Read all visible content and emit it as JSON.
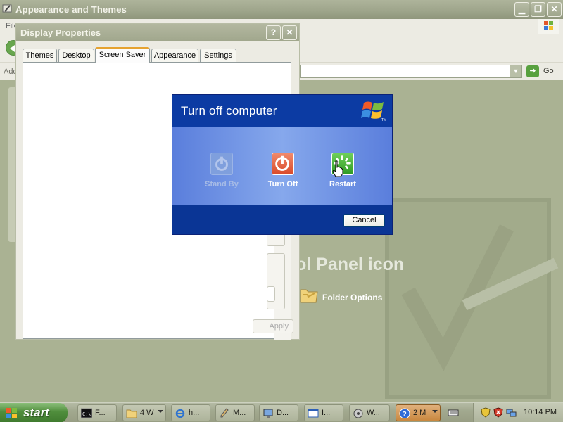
{
  "background_window": {
    "title": "Appearance and Themes",
    "menu_file": "File",
    "address_label": "Address",
    "go_label": "Go",
    "watermark_title": "ol Panel icon",
    "folder_options_label": "Folder Options",
    "minimize_glyph": "▁",
    "restore_glyph": "❐",
    "close_glyph": "✕"
  },
  "display_properties": {
    "title": "Display Properties",
    "help_glyph": "?",
    "close_glyph": "✕",
    "tabs": [
      {
        "label": "Themes"
      },
      {
        "label": "Desktop"
      },
      {
        "label": "Screen Saver",
        "active": true
      },
      {
        "label": "Appearance"
      },
      {
        "label": "Settings"
      }
    ],
    "apply_label": "Apply"
  },
  "turn_off_dialog": {
    "title": "Turn off computer",
    "trademark": "TM",
    "options": [
      {
        "label": "Stand By",
        "icon": "standby-icon",
        "enabled": false
      },
      {
        "label": "Turn Off",
        "icon": "power-icon",
        "enabled": true
      },
      {
        "label": "Restart",
        "icon": "restart-icon",
        "enabled": true
      }
    ],
    "cancel_label": "Cancel"
  },
  "taskbar": {
    "start_label": "start",
    "buttons": [
      {
        "label": "F...",
        "icon": "cmd-icon"
      },
      {
        "label": "4 W",
        "icon": "folder-icon",
        "grouped": true
      },
      {
        "label": "h...",
        "icon": "ie-icon",
        "grouped": true
      },
      {
        "label": "M...",
        "icon": "paint-icon"
      },
      {
        "label": "D...",
        "icon": "control-panel-icon"
      },
      {
        "label": "I...",
        "icon": "window-icon"
      },
      {
        "label": "W...",
        "icon": "speaker-icon"
      },
      {
        "label": "2 M",
        "icon": "help-icon",
        "grouped": true,
        "active": true
      },
      {
        "label": "",
        "icon": "keyboard-icon"
      }
    ],
    "clock": "10:14 PM"
  },
  "colors": {
    "xp_blue": "#083493",
    "turnoff_red": "#d94a2a",
    "restart_green": "#2e9a24",
    "start_green": "#4f8d3c"
  }
}
